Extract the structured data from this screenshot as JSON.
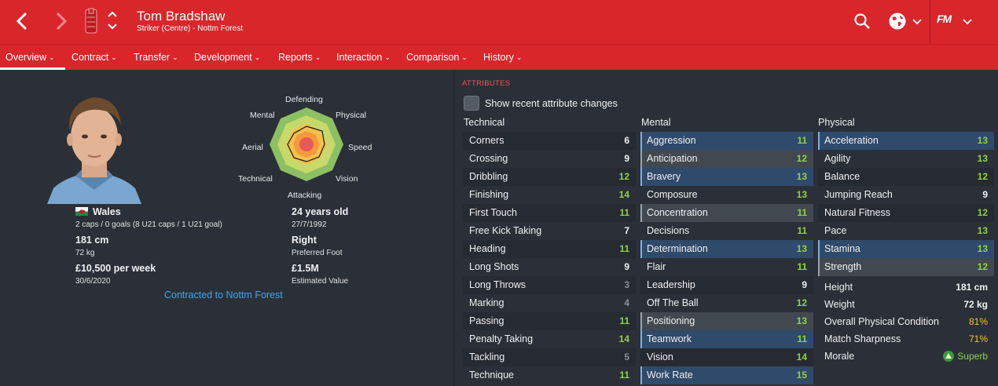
{
  "header": {
    "player_name": "Tom Bradshaw",
    "player_subtitle": "Striker (Centre) - Nottm Forest",
    "icons": [
      "back-icon",
      "forward-icon",
      "club-crest-icon",
      "up-down-icon",
      "search-icon",
      "globe-icon",
      "chevron-down-icon",
      "fm-logo"
    ],
    "fm_label": "FM"
  },
  "menu": [
    {
      "label": "Overview",
      "active": true
    },
    {
      "label": "Contract"
    },
    {
      "label": "Transfer"
    },
    {
      "label": "Development"
    },
    {
      "label": "Reports"
    },
    {
      "label": "Interaction"
    },
    {
      "label": "Comparison"
    },
    {
      "label": "History"
    }
  ],
  "profile": {
    "nation": "Wales",
    "caps": "2 caps / 0 goals (8 U21 caps / 1 U21 goal)",
    "height": "181 cm",
    "weight": "72 kg",
    "wage": "£10,500 per week",
    "contract_end": "30/6/2020",
    "age": "24 years old",
    "dob": "27/7/1992",
    "foot": "Right",
    "foot_label": "Preferred Foot",
    "value": "£1.5M",
    "value_label": "Estimated Value",
    "contract_link": "Contracted to Nottm Forest"
  },
  "radar": {
    "labels": {
      "defending": "Defending",
      "physical": "Physical",
      "speed": "Speed",
      "vision": "Vision",
      "attacking": "Attacking",
      "technical": "Technical",
      "aerial": "Aerial",
      "mental": "Mental"
    }
  },
  "attributes": {
    "title": "ATTRIBUTES",
    "show_changes_label": "Show recent attribute changes",
    "technical": {
      "heading": "Technical",
      "rows": [
        {
          "name": "Corners",
          "value": "6"
        },
        {
          "name": "Crossing",
          "value": "9"
        },
        {
          "name": "Dribbling",
          "value": "12"
        },
        {
          "name": "Finishing",
          "value": "14"
        },
        {
          "name": "First Touch",
          "value": "11"
        },
        {
          "name": "Free Kick Taking",
          "value": "7"
        },
        {
          "name": "Heading",
          "value": "11"
        },
        {
          "name": "Long Shots",
          "value": "9"
        },
        {
          "name": "Long Throws",
          "value": "3"
        },
        {
          "name": "Marking",
          "value": "4"
        },
        {
          "name": "Passing",
          "value": "11"
        },
        {
          "name": "Penalty Taking",
          "value": "14"
        },
        {
          "name": "Tackling",
          "value": "5"
        },
        {
          "name": "Technique",
          "value": "11"
        }
      ]
    },
    "mental": {
      "heading": "Mental",
      "rows": [
        {
          "name": "Aggression",
          "value": "11"
        },
        {
          "name": "Anticipation",
          "value": "12"
        },
        {
          "name": "Bravery",
          "value": "13"
        },
        {
          "name": "Composure",
          "value": "13"
        },
        {
          "name": "Concentration",
          "value": "11"
        },
        {
          "name": "Decisions",
          "value": "11"
        },
        {
          "name": "Determination",
          "value": "13"
        },
        {
          "name": "Flair",
          "value": "11"
        },
        {
          "name": "Leadership",
          "value": "9"
        },
        {
          "name": "Off The Ball",
          "value": "12"
        },
        {
          "name": "Positioning",
          "value": "13"
        },
        {
          "name": "Teamwork",
          "value": "11"
        },
        {
          "name": "Vision",
          "value": "14"
        },
        {
          "name": "Work Rate",
          "value": "15"
        }
      ]
    },
    "physical": {
      "heading": "Physical",
      "rows": [
        {
          "name": "Acceleration",
          "value": "13"
        },
        {
          "name": "Agility",
          "value": "13"
        },
        {
          "name": "Balance",
          "value": "12"
        },
        {
          "name": "Jumping Reach",
          "value": "9"
        },
        {
          "name": "Natural Fitness",
          "value": "12"
        },
        {
          "name": "Pace",
          "value": "13"
        },
        {
          "name": "Stamina",
          "value": "13"
        },
        {
          "name": "Strength",
          "value": "12"
        }
      ]
    },
    "info": {
      "height_label": "Height",
      "height_value": "181 cm",
      "weight_label": "Weight",
      "weight_value": "72 kg",
      "condition_label": "Overall Physical Condition",
      "condition_value": "81%",
      "sharpness_label": "Match Sharpness",
      "sharpness_value": "71%",
      "morale_label": "Morale",
      "morale_value": "Superb"
    }
  },
  "colors": {
    "header_red": "#d9262b",
    "background": "#2b3038",
    "good_value": "#8ed24a",
    "warn_value": "#f2c230",
    "link": "#42a5e6"
  }
}
